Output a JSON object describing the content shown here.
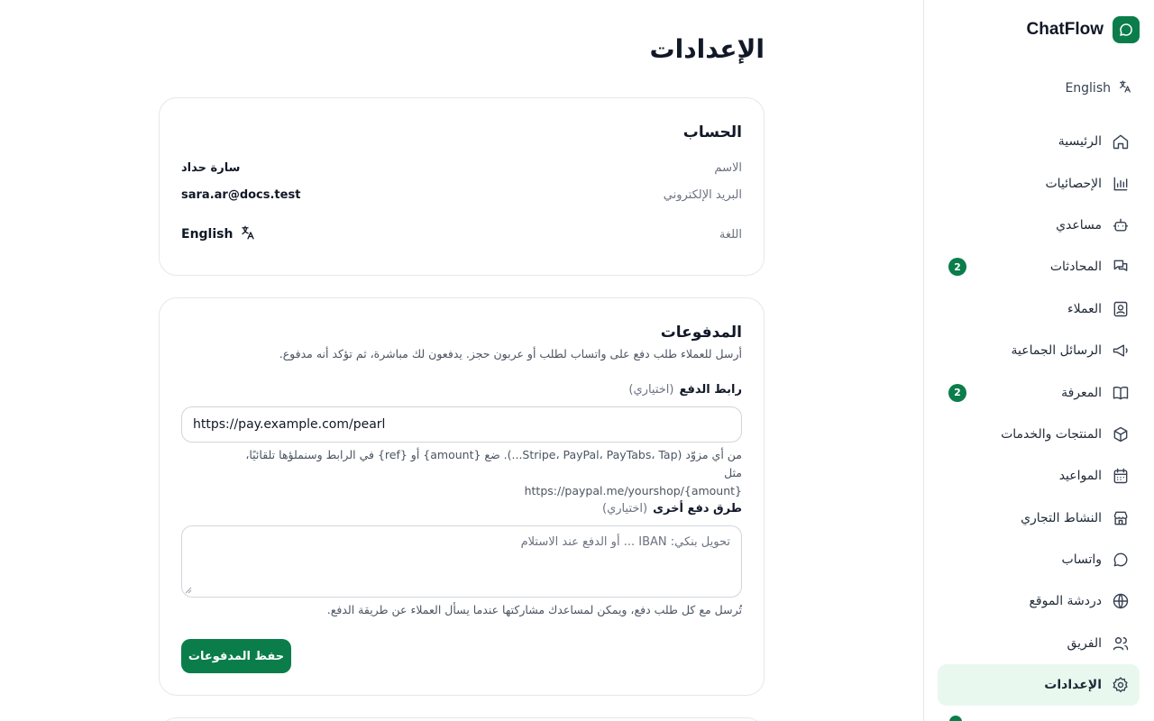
{
  "brand": {
    "name": "ChatFlow",
    "logo_icon": "chat-bubble-icon",
    "color": "#0a7d4b"
  },
  "language_switch": {
    "label": "English",
    "icon": "translate-icon"
  },
  "nav": {
    "items": [
      {
        "label": "الرئيسية",
        "icon": "home-icon"
      },
      {
        "label": "الإحصائيات",
        "icon": "bar-chart-icon"
      },
      {
        "label": "مساعدي",
        "icon": "bot-icon"
      },
      {
        "label": "المحادثات",
        "icon": "chats-icon",
        "badge": "2"
      },
      {
        "label": "العملاء",
        "icon": "contact-icon"
      },
      {
        "label": "الرسائل الجماعية",
        "icon": "megaphone-icon"
      },
      {
        "label": "المعرفة",
        "icon": "book-icon",
        "badge": "2"
      },
      {
        "label": "المنتجات والخدمات",
        "icon": "box-icon"
      },
      {
        "label": "المواعيد",
        "icon": "calendar-icon"
      },
      {
        "label": "النشاط التجاري",
        "icon": "store-icon"
      },
      {
        "label": "واتساب",
        "icon": "whatsapp-icon"
      },
      {
        "label": "دردشة الموقع",
        "icon": "globe-icon"
      },
      {
        "label": "الفريق",
        "icon": "team-icon"
      },
      {
        "label": "الإعدادات",
        "icon": "settings-icon",
        "active": true
      }
    ]
  },
  "page": {
    "title": "الإعدادات"
  },
  "account": {
    "title": "الحساب",
    "name_label": "الاسم",
    "name_value": "سارة حداد",
    "email_label": "البريد الإلكتروني",
    "email_value": "sara.ar@docs.test",
    "language_label": "اللغة",
    "language_value": "English"
  },
  "payments": {
    "title": "المدفوعات",
    "description": "أرسل للعملاء طلب دفع على واتساب لطلب أو عربون حجز. يدفعون لك مباشرة، ثم تؤكد أنه مدفوع.",
    "link_label": "رابط الدفع",
    "optional": "(اختياري)",
    "link_value": "https://pay.example.com/pearl",
    "link_help": "من أي مزوّد (Stripe، PayPal، PayTabs، Tap...). ضع {amount} أو {ref} في الرابط وسنملؤها تلقائيًا، مثل",
    "link_help_example": "https://paypal.me/yourshop/{amount}",
    "other_label": "طرق دفع أخرى",
    "other_placeholder": "تحويل بنكي: IBAN ... أو الدفع عند الاستلام",
    "other_help": "تُرسل مع كل طلب دفع، ويمكن لمساعدك مشاركتها عندما يسأل العملاء عن طريقة الدفع.",
    "save_label": "حفظ المدفوعات"
  }
}
